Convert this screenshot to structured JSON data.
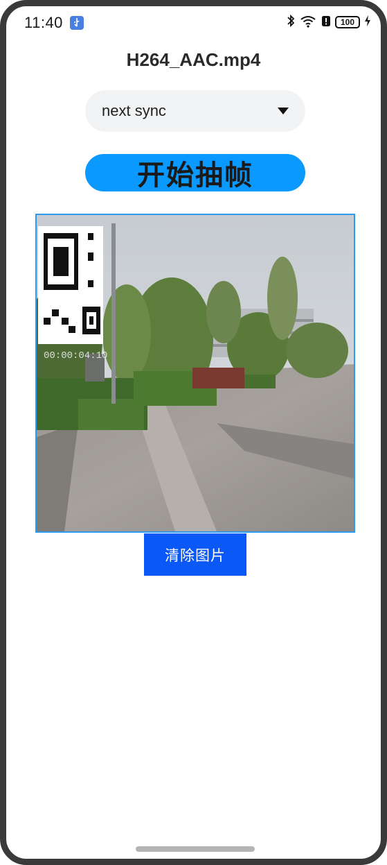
{
  "status_bar": {
    "time": "11:40",
    "battery_level": "100"
  },
  "header": {
    "title": "H264_AAC.mp4"
  },
  "mode_select": {
    "selected": "next sync"
  },
  "start_button": {
    "label": "开始抽帧"
  },
  "video_frame": {
    "timestamp": "00:00:04:10"
  },
  "clear_button": {
    "label": "清除图片"
  },
  "colors": {
    "accent_blue": "#0a99ff",
    "clear_button_blue": "#0a59f7",
    "image_border": "#2b9bf2",
    "select_bg": "#f1f3f5"
  }
}
